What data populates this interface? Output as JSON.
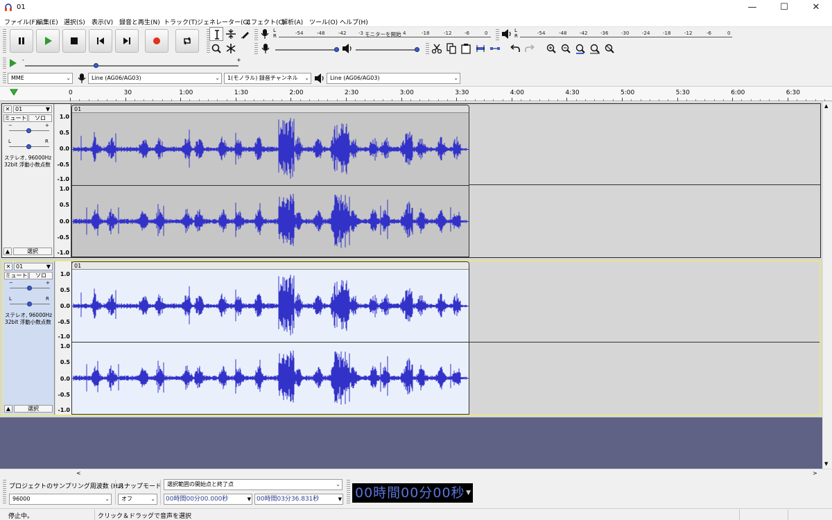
{
  "window": {
    "title": "01",
    "minimize": "—",
    "maximize": "☐",
    "close": "✕"
  },
  "menu": [
    "ファイル(F)",
    "編集(E)",
    "選択(S)",
    "表示(V)",
    "録音と再生(N)",
    "トラック(T)",
    "ジェネレーター(G)",
    "エフェクト(C)",
    "解析(A)",
    "ツール(O)",
    "ヘルプ(H)"
  ],
  "transport": [
    "pause",
    "play",
    "stop",
    "skip-to-start",
    "skip-to-end",
    "record",
    "loop"
  ],
  "meters": {
    "record_ticks": [
      "-54",
      "-48",
      "-42",
      "-3",
      "-18",
      "-12",
      "-6",
      "0"
    ],
    "record_monitor_label": "モニターを開始",
    "record_monitor_suffix": "4",
    "play_ticks": [
      "-54",
      "-48",
      "-42",
      "-36",
      "-30",
      "-24",
      "-18",
      "-12",
      "-6",
      "0"
    ],
    "left": "L",
    "right": "R"
  },
  "devices": {
    "host": "MME",
    "recording_device": "Line (AG06/AG03)",
    "channels": "1(モノラル) 録音チャンネル",
    "playback_device": "Line (AG06/AG03)"
  },
  "playback_speed": 0.5,
  "ruler": [
    "0",
    "30",
    "1:00",
    "1:30",
    "2:00",
    "2:30",
    "3:00",
    "3:30",
    "4:00",
    "4:30",
    "5:00",
    "5:30",
    "6:00",
    "6:30"
  ],
  "tracks": [
    {
      "name": "01",
      "clip_name": "01",
      "mute": "ミュート",
      "solo": "ソロ",
      "gain_minus": "−",
      "gain_plus": "+",
      "pan_left": "L",
      "pan_right": "R",
      "info_line1": "ステレオ, 96000Hz",
      "info_line2": "32bit 浮動小数点数",
      "select": "選択",
      "selected": false,
      "scale": [
        "1.0",
        "0.5",
        "0.0",
        "-0.5",
        "-1.0"
      ]
    },
    {
      "name": "01",
      "clip_name": "01",
      "mute": "ミュート",
      "solo": "ソロ",
      "gain_minus": "−",
      "gain_plus": "+",
      "pan_left": "L",
      "pan_right": "R",
      "info_line1": "ステレオ, 96000Hz",
      "info_line2": "32bit 浮動小数点数",
      "select": "選択",
      "selected": true,
      "scale": [
        "1.0",
        "0.5",
        "0.0",
        "-0.5",
        "-1.0"
      ]
    }
  ],
  "bottom": {
    "rate_label": "プロジェクトのサンプリング周波数 (Hz)",
    "rate_value": "96000",
    "snap_label": "スナップモード",
    "snap_value": "オフ",
    "selection_mode": "選択範囲の開始点と終了点",
    "start_time": "00時間00分00.000秒",
    "end_time": "00時間03分36.831秒",
    "audio_position": "00時間00分00秒"
  },
  "status": {
    "left": "停止中。",
    "right": "クリック＆ドラッグで音声を選択"
  },
  "colors": {
    "waveform": "#3232c8",
    "selected_track_border": "#e8e48a",
    "background_below": "#5f6284",
    "time_display_text": "#5b74d9"
  }
}
